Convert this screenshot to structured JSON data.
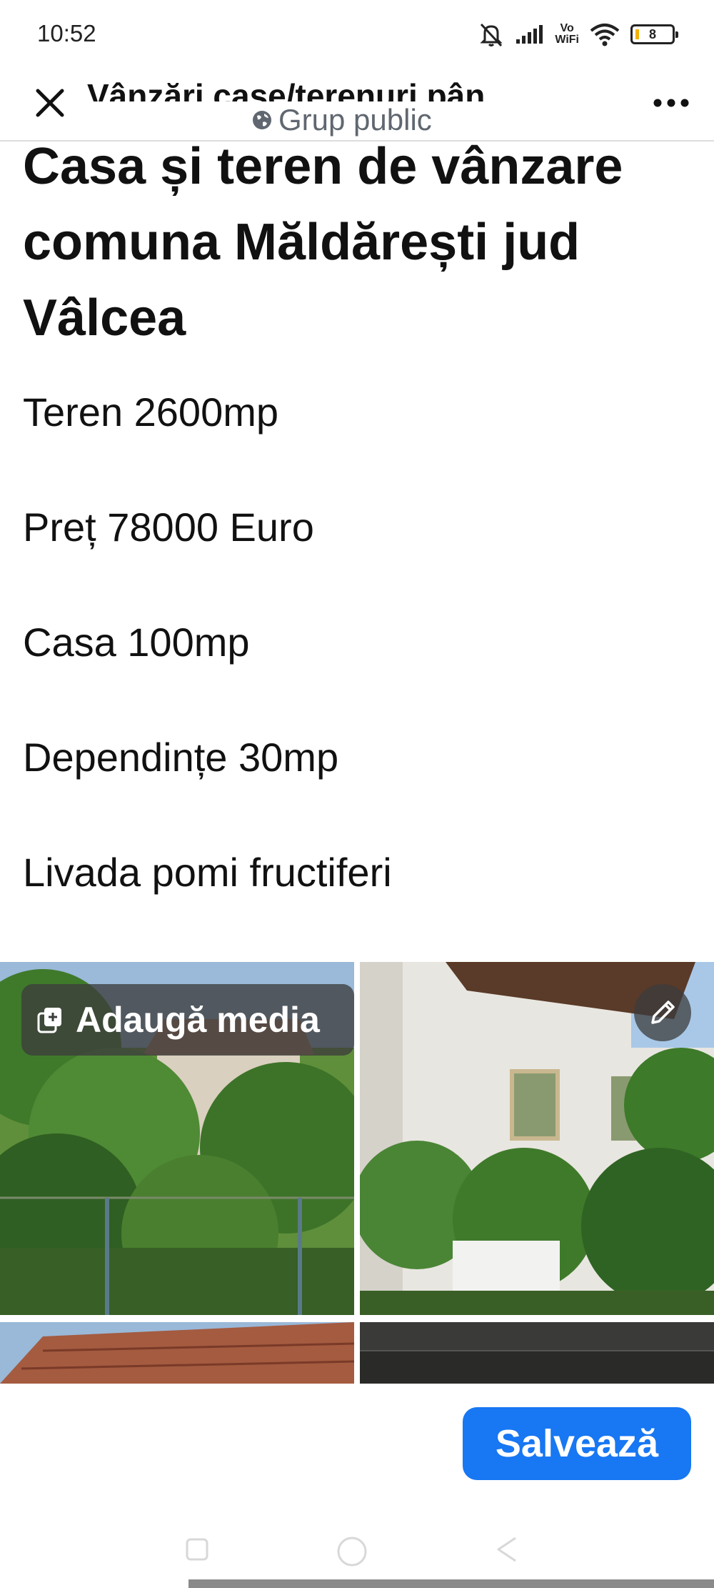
{
  "status_bar": {
    "time": "10:52",
    "vowifi_top": "Vo",
    "vowifi_bottom": "WiFi",
    "battery": "8"
  },
  "header": {
    "title": "Vânzări case/terenuri pân",
    "subtitle": "Grup public"
  },
  "post": {
    "title": "Casa și teren de vânzare comuna Măldărești jud Vâlcea",
    "lines": [
      "Teren 2600mp",
      "Preț 78000 Euro",
      "Casa 100mp",
      "Dependințe 30mp",
      "Livada pomi fructiferi"
    ]
  },
  "media": {
    "add_media_label": "Adaugă media"
  },
  "footer": {
    "save_label": "Salvează"
  },
  "icons": {
    "close": "close-icon",
    "globe": "globe-icon",
    "more": "more-icon",
    "add_media": "add-media-icon",
    "edit": "pencil-icon"
  },
  "colors": {
    "accent": "#1877f2",
    "muted_text": "#606770"
  }
}
